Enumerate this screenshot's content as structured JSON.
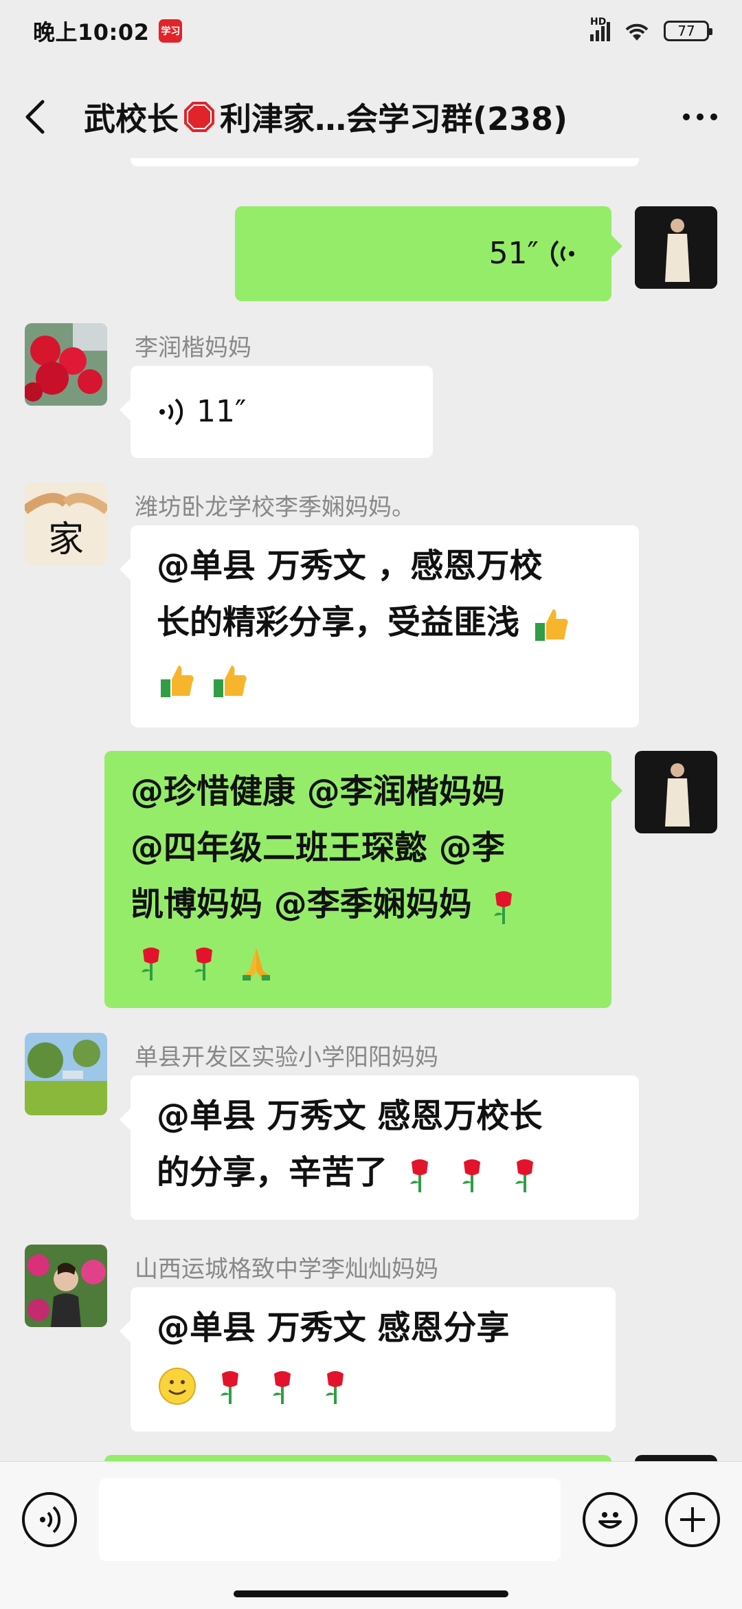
{
  "status_bar": {
    "time": "晚上10:02",
    "app_badge": "学习",
    "network": "HD",
    "battery": "77"
  },
  "header": {
    "title_part1": "武校长",
    "title_part2": "利津家…会学习群(238)"
  },
  "messages": [
    {
      "id": "m1",
      "side": "right",
      "type": "voice",
      "duration": "51″"
    },
    {
      "id": "m2",
      "side": "left",
      "type": "voice",
      "sender": "李润楷妈妈",
      "duration": "11″"
    },
    {
      "id": "m3",
      "side": "left",
      "type": "text",
      "sender": "潍坊卧龙学校李季娴妈妈。",
      "text_line1": "@单县  万秀文 ，感恩万校",
      "text_line2": "长的精彩分享，受益匪浅"
    },
    {
      "id": "m4",
      "side": "right",
      "type": "text",
      "text_line1": "@珍惜健康 @李润楷妈妈",
      "text_line2": "@四年级二班王琛懿 @李",
      "text_line3": "凯博妈妈 @李季娴妈妈"
    },
    {
      "id": "m5",
      "side": "left",
      "type": "text",
      "sender": "单县开发区实验小学阳阳妈妈",
      "text_line1": "@单县  万秀文  感恩万校长",
      "text_line2": "的分享，辛苦了"
    },
    {
      "id": "m6",
      "side": "left",
      "type": "text",
      "sender": "山西运城格致中学李灿灿妈妈",
      "text_line1": "@单县  万秀文  感恩分享"
    }
  ],
  "icons": {
    "thumbs_up": "thumbs-up-icon",
    "rose": "rose-icon",
    "pray": "pray-icon",
    "smile": "smile-icon"
  },
  "colors": {
    "my_bubble": "#95ec69",
    "other_bubble": "#ffffff",
    "background": "#ededed"
  }
}
